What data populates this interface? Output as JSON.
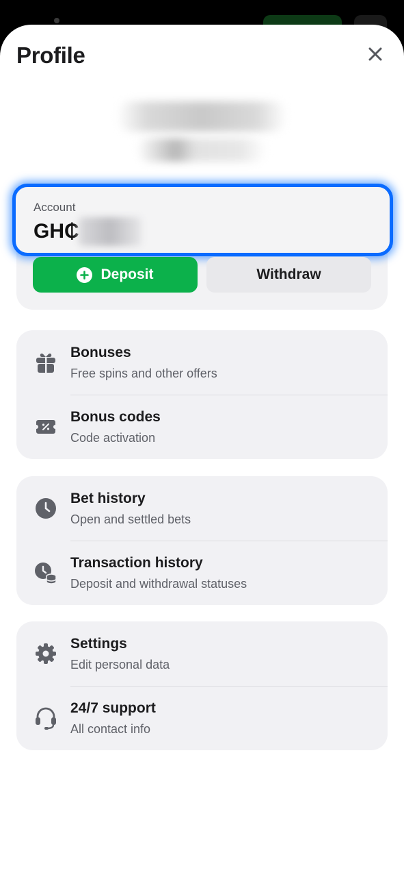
{
  "header": {
    "title": "Profile"
  },
  "account": {
    "label": "Account",
    "currency": "GH₵"
  },
  "actions": {
    "deposit_label": "Deposit",
    "withdraw_label": "Withdraw"
  },
  "groups": [
    {
      "items": [
        {
          "title": "Bonuses",
          "subtitle": "Free spins and other offers",
          "icon": "gift-icon"
        },
        {
          "title": "Bonus codes",
          "subtitle": "Code activation",
          "icon": "coupon-icon"
        }
      ]
    },
    {
      "items": [
        {
          "title": "Bet history",
          "subtitle": "Open and settled bets",
          "icon": "clock-icon"
        },
        {
          "title": "Transaction history",
          "subtitle": "Deposit and withdrawal statuses",
          "icon": "clock-coins-icon"
        }
      ]
    },
    {
      "items": [
        {
          "title": "Settings",
          "subtitle": "Edit personal data",
          "icon": "gear-icon"
        },
        {
          "title": "24/7 support",
          "subtitle": "All contact info",
          "icon": "headset-icon"
        }
      ]
    }
  ],
  "colors": {
    "accent_blue": "#0a6bff",
    "deposit_green": "#0cb14b",
    "icon_gray": "#5f6168"
  }
}
